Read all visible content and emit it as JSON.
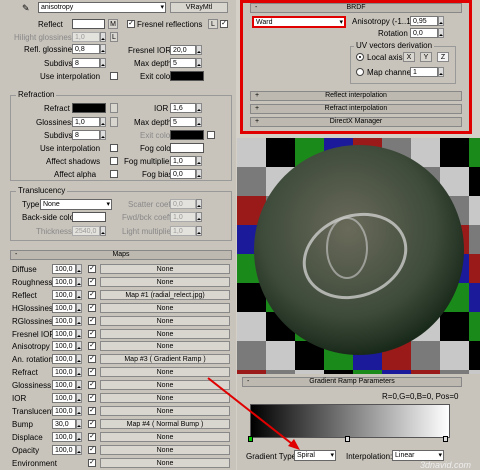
{
  "header": {
    "picker": "anisotropy",
    "type_btn": "VRayMtl"
  },
  "reflection": {
    "reflect": "Reflect",
    "m": "M",
    "hilight_gloss": "Hilight glossiness",
    "hilight_val": "1,0",
    "l": "L",
    "refl_gloss": "Refl. glossiness",
    "refl_gloss_val": "0,8",
    "subdivs": "Subdivs",
    "subdivs_val": "8",
    "use_interp": "Use interpolation",
    "fresnel": "Fresnel reflections",
    "fresnel_ior": "Fresnel IOR",
    "fresnel_ior_val": "20,0",
    "max_depth": "Max depth",
    "max_depth_val": "5",
    "exit_color": "Exit color"
  },
  "refraction": {
    "title": "Refraction",
    "refract": "Refract",
    "ior": "IOR",
    "ior_val": "1,6",
    "gloss": "Glossiness",
    "gloss_val": "1,0",
    "max_depth": "Max depth",
    "max_depth_val": "5",
    "subdivs": "Subdivs",
    "subdivs_val": "8",
    "exit_color": "Exit color",
    "use_interp": "Use interpolation",
    "fog_color": "Fog color",
    "affect_shadows": "Affect shadows",
    "fog_mult": "Fog multiplier",
    "fog_mult_val": "1,0",
    "affect_alpha": "Affect alpha",
    "fog_bias": "Fog bias",
    "fog_bias_val": "0,0"
  },
  "translucency": {
    "title": "Translucency",
    "type": "Type",
    "type_val": "None",
    "scatter": "Scatter coeff",
    "scatter_val": "0,0",
    "back_side": "Back-side color",
    "fwd_bck": "Fwd/bck coeff",
    "fwd_bck_val": "1,0",
    "thickness": "Thickness",
    "thickness_val": "2540,0",
    "light_mult": "Light multiplier",
    "light_mult_val": "1,0"
  },
  "maps": {
    "title": "Maps",
    "rows": [
      {
        "name": "Diffuse",
        "amount": "100,0",
        "map": "None"
      },
      {
        "name": "Roughness",
        "amount": "100,0",
        "map": "None"
      },
      {
        "name": "Reflect",
        "amount": "100,0",
        "map": "Map #1 (radial_relect.jpg)"
      },
      {
        "name": "HGlossiness",
        "amount": "100,0",
        "map": "None"
      },
      {
        "name": "RGlossiness",
        "amount": "100,0",
        "map": "None"
      },
      {
        "name": "Fresnel IOR",
        "amount": "100,0",
        "map": "None"
      },
      {
        "name": "Anisotropy",
        "amount": "100,0",
        "map": "None"
      },
      {
        "name": "An. rotation",
        "amount": "100,0",
        "map": "Map #3 ( Gradient Ramp )"
      },
      {
        "name": "Refract",
        "amount": "100,0",
        "map": "None"
      },
      {
        "name": "Glossiness",
        "amount": "100,0",
        "map": "None"
      },
      {
        "name": "IOR",
        "amount": "100,0",
        "map": "None"
      },
      {
        "name": "Translucent",
        "amount": "100,0",
        "map": "None"
      },
      {
        "name": "Bump",
        "amount": "30,0",
        "map": "Map #4 ( Normal Bump )"
      },
      {
        "name": "Displace",
        "amount": "100,0",
        "map": "None"
      },
      {
        "name": "Opacity",
        "amount": "100,0",
        "map": "None"
      },
      {
        "name": "Environment",
        "amount": "",
        "map": "None"
      }
    ]
  },
  "brdf": {
    "title": "BRDF",
    "type": "Ward",
    "aniso": "Anisotropy (-1..1)",
    "aniso_val": "0,95",
    "rotation": "Rotation",
    "rotation_val": "0,0",
    "uv_title": "UV vectors derivation",
    "local_axis": "Local axis",
    "x": "X",
    "y": "Y",
    "z": "Z",
    "map_channel": "Map channel",
    "map_channel_val": "1"
  },
  "rollouts": {
    "reflect_interp": "Reflect interpolation",
    "refract_interp": "Refract interpolation",
    "directx": "DirectX Manager"
  },
  "gradient": {
    "title": "Gradient Ramp Parameters",
    "readout": "R=0,G=0,B=0, Pos=0",
    "gradient_type_label": "Gradient Type:",
    "gradient_type": "Spiral",
    "interp_label": "Interpolation:",
    "interp": "Linear"
  },
  "watermark": "3dnavid.com"
}
